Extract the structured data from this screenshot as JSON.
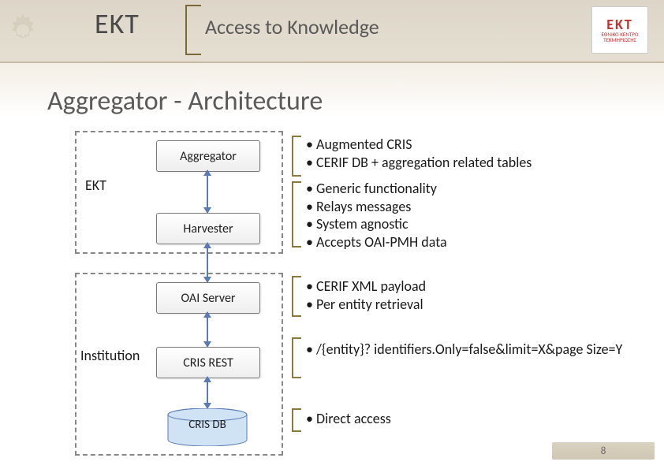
{
  "header": {
    "org": "EKT",
    "subtitle": "Access to Knowledge",
    "logo_text": "EKT",
    "logo_sub1": "ΕΘΝΙΚΟ ΚΕΝΤΡΟ",
    "logo_sub2": "ΤΕΚΜΗΡΙΩΣΗΣ"
  },
  "title": "Aggregator - Architecture",
  "group_labels": {
    "ekt": "EKT",
    "institution": "Institution"
  },
  "boxes": {
    "aggregator": "Aggregator",
    "harvester": "Harvester",
    "oai_server": "OAI Server",
    "cris_rest": "CRIS REST",
    "cris_db": "CRIS DB"
  },
  "descriptions": {
    "aggregator": [
      "• Augmented CRIS",
      "• CERIF DB + aggregation related tables"
    ],
    "harvester": [
      "• Generic functionality",
      "• Relays messages",
      "• System agnostic",
      "• Accepts OAI-PMH data"
    ],
    "oai_server": [
      "• CERIF XML payload",
      "• Per entity retrieval"
    ],
    "cris_rest": [
      "• /{entity}? identifiers.Only=false&limit=X&page Size=Y"
    ],
    "cris_db": [
      "• Direct access"
    ]
  },
  "page_number": "8"
}
